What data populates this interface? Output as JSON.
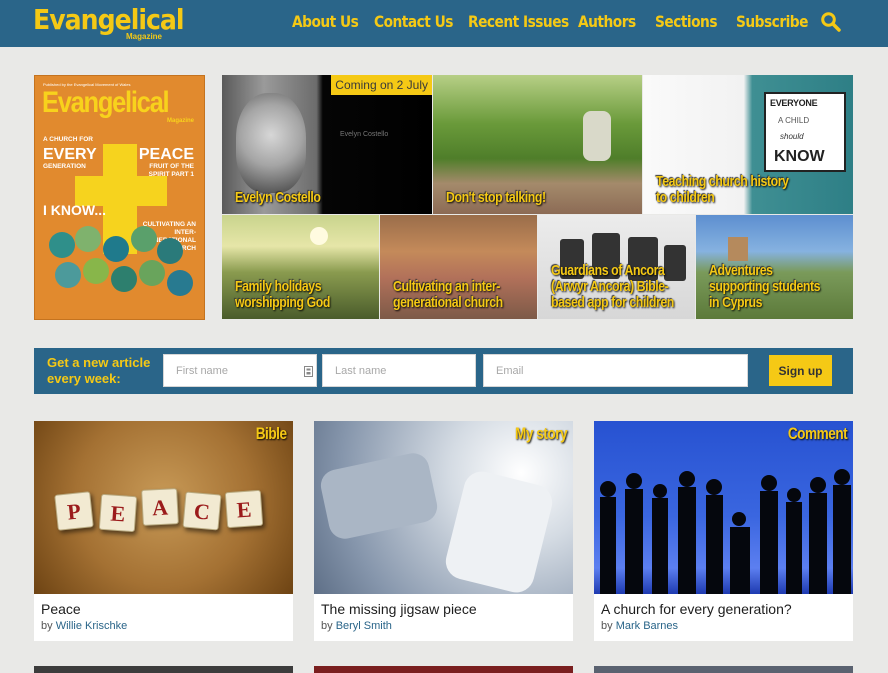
{
  "header": {
    "logo": "Evangelical",
    "logo_sub": "Magazine",
    "nav": [
      "About Us",
      "Contact Us",
      "Recent Issues",
      "Authors",
      "Sections",
      "Subscribe"
    ],
    "search_icon": "search-icon"
  },
  "cover": {
    "top_line": "Published by the Evangelical Movement of Wales",
    "title": "Evangelical",
    "mag": "Magazine",
    "t1": "A CHURCH FOR",
    "t2": "EVERY",
    "t3": "GENERATION",
    "t4": "PEACE",
    "t5": "FRUIT OF THE SPIRIT PART 1",
    "t6": "I KNOW...",
    "t7": "CULTIVATING AN INTER-GENERATIONAL CHURCH"
  },
  "featured": [
    {
      "caption": "Evelyn Costello",
      "badge": "Coming on 2 July",
      "photo_label": "Evelyn Costello"
    },
    {
      "caption": "Don't stop talking!"
    },
    {
      "caption": "Teaching church history to children",
      "board": [
        "EVERYONE",
        "A CHILD",
        "should",
        "KNOW"
      ]
    },
    {
      "caption": "Family holidays worshipping God"
    },
    {
      "caption": "Cultivating an inter-generational church"
    },
    {
      "caption": "Guardians of Ancora (Arwyr Ancora) Bible-based app for children"
    },
    {
      "caption": "Adventures supporting students in Cyprus"
    }
  ],
  "signup": {
    "text": "Get a new article every week:",
    "first_name_placeholder": "First name",
    "last_name_placeholder": "Last name",
    "email_placeholder": "Email",
    "button": "Sign up"
  },
  "articles": [
    {
      "section": "Bible",
      "title": "Peace",
      "by": "by",
      "author": "Willie Krischke",
      "tiles": [
        "P",
        "E",
        "A",
        "C",
        "E"
      ]
    },
    {
      "section": "My story",
      "title": "The missing jigsaw piece",
      "by": "by",
      "author": "Beryl Smith"
    },
    {
      "section": "Comment",
      "title": "A church for every generation?",
      "by": "by",
      "author": "Mark Barnes"
    }
  ],
  "colors": {
    "brand_blue": "#2a6589",
    "brand_yellow": "#f5c915"
  }
}
